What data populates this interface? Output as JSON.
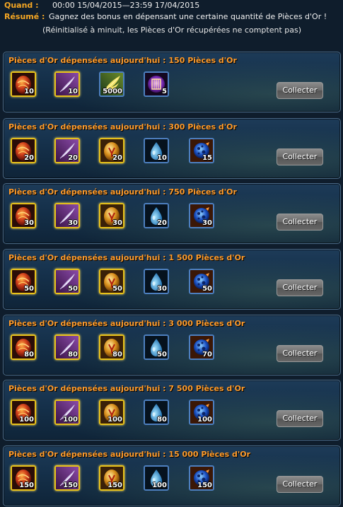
{
  "header": {
    "when_label": "Quand :",
    "when_value": "00:00 15/04/2015—23:59 17/04/2015",
    "summary_label": "Résumé :",
    "summary_value": "Gagnez des bonus en dépensant une certaine quantité de Pièces d'Or !",
    "summary_note": "(Réinitialisé à minuit, les Pièces d'Or récupérées ne comptent pas)"
  },
  "tiers": [
    {
      "title": "Pièces d'Or dépensées aujourd'hui :  150 Pièces d'Or",
      "button": "Collecter",
      "items": [
        {
          "icon": "red-egg-icon",
          "frame": "gold",
          "qty": "10"
        },
        {
          "icon": "white-feather-icon",
          "frame": "gold",
          "qty": "10"
        },
        {
          "icon": "golden-wing-icon",
          "frame": "blue",
          "qty": "5000"
        },
        {
          "icon": "purple-cage-orb-icon",
          "frame": "blue",
          "qty": "5"
        }
      ]
    },
    {
      "title": "Pièces d'Or dépensées aujourd'hui :  300 Pièces d'Or",
      "button": "Collecter",
      "items": [
        {
          "icon": "red-egg-icon",
          "frame": "gold",
          "qty": "20"
        },
        {
          "icon": "white-feather-icon",
          "frame": "gold",
          "qty": "20"
        },
        {
          "icon": "golden-egg-icon",
          "frame": "gold",
          "qty": "20"
        },
        {
          "icon": "water-drop-icon",
          "frame": "blue",
          "qty": "10"
        },
        {
          "icon": "blue-orb-icon",
          "frame": "blue",
          "qty": "15"
        }
      ]
    },
    {
      "title": "Pièces d'Or dépensées aujourd'hui :  750 Pièces d'Or",
      "button": "Collecter",
      "items": [
        {
          "icon": "red-egg-icon",
          "frame": "gold",
          "qty": "30"
        },
        {
          "icon": "white-feather-icon",
          "frame": "gold",
          "qty": "30"
        },
        {
          "icon": "golden-egg-icon",
          "frame": "gold",
          "qty": "30"
        },
        {
          "icon": "water-drop-icon",
          "frame": "blue",
          "qty": "20"
        },
        {
          "icon": "blue-orb-icon",
          "frame": "blue",
          "qty": "30"
        }
      ]
    },
    {
      "title": "Pièces d'Or dépensées aujourd'hui :  1 500 Pièces d'Or",
      "button": "Collecter",
      "items": [
        {
          "icon": "red-egg-icon",
          "frame": "gold",
          "qty": "50"
        },
        {
          "icon": "white-feather-icon",
          "frame": "gold",
          "qty": "50"
        },
        {
          "icon": "golden-egg-icon",
          "frame": "gold",
          "qty": "50"
        },
        {
          "icon": "water-drop-icon",
          "frame": "blue",
          "qty": "30"
        },
        {
          "icon": "blue-orb-icon",
          "frame": "blue",
          "qty": "50"
        }
      ]
    },
    {
      "title": "Pièces d'Or dépensées aujourd'hui :  3 000 Pièces d'Or",
      "button": "Collecter",
      "items": [
        {
          "icon": "red-egg-icon",
          "frame": "gold",
          "qty": "80"
        },
        {
          "icon": "white-feather-icon",
          "frame": "gold",
          "qty": "80"
        },
        {
          "icon": "golden-egg-icon",
          "frame": "gold",
          "qty": "80"
        },
        {
          "icon": "water-drop-icon",
          "frame": "blue",
          "qty": "50"
        },
        {
          "icon": "blue-orb-icon",
          "frame": "blue",
          "qty": "70"
        }
      ]
    },
    {
      "title": "Pièces d'Or dépensées aujourd'hui :  7 500 Pièces d'Or",
      "button": "Collecter",
      "items": [
        {
          "icon": "red-egg-icon",
          "frame": "gold",
          "qty": "100"
        },
        {
          "icon": "white-feather-icon",
          "frame": "gold",
          "qty": "100"
        },
        {
          "icon": "golden-egg-icon",
          "frame": "gold",
          "qty": "100"
        },
        {
          "icon": "water-drop-icon",
          "frame": "blue",
          "qty": "80"
        },
        {
          "icon": "blue-orb-icon",
          "frame": "blue",
          "qty": "100"
        }
      ]
    },
    {
      "title": "Pièces d'Or dépensées aujourd'hui :  15 000 Pièces d'Or",
      "button": "Collecter",
      "items": [
        {
          "icon": "red-egg-icon",
          "frame": "gold",
          "qty": "150"
        },
        {
          "icon": "white-feather-icon",
          "frame": "gold",
          "qty": "150"
        },
        {
          "icon": "golden-egg-icon",
          "frame": "gold",
          "qty": "150"
        },
        {
          "icon": "water-drop-icon",
          "frame": "blue",
          "qty": "100"
        },
        {
          "icon": "blue-orb-icon",
          "frame": "blue",
          "qty": "150"
        }
      ]
    }
  ]
}
